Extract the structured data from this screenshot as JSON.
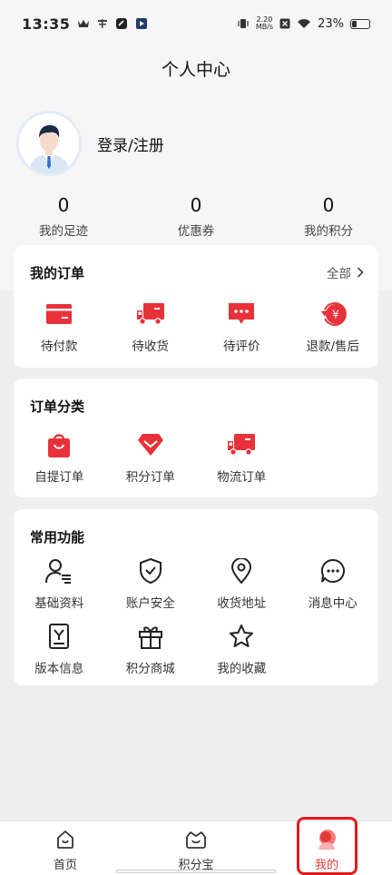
{
  "status_bar": {
    "time": "13:35",
    "speed_top": "2.20",
    "speed_bottom": "MB/s",
    "battery": "23%",
    "left_icons": [
      "crown-icon",
      "qin-app-icon",
      "link-app-icon",
      "play-app-icon"
    ],
    "right_icons": [
      "vibrate-icon",
      "x-app-icon",
      "wifi-icon",
      "battery-icon"
    ]
  },
  "header": {
    "title": "个人中心"
  },
  "profile": {
    "login_label": "登录/注册",
    "avatar_icon": "default-avatar"
  },
  "stats": [
    {
      "value": "0",
      "label": "我的足迹"
    },
    {
      "value": "0",
      "label": "优惠券"
    },
    {
      "value": "0",
      "label": "我的积分"
    }
  ],
  "orders": {
    "title": "我的订单",
    "more_label": "全部",
    "items": [
      {
        "label": "待付款",
        "icon": "wallet-card-icon"
      },
      {
        "label": "待收货",
        "icon": "truck-icon"
      },
      {
        "label": "待评价",
        "icon": "comment-icon"
      },
      {
        "label": "退款/售后",
        "icon": "refund-yen-icon"
      }
    ]
  },
  "categories": {
    "title": "订单分类",
    "items": [
      {
        "label": "自提订单",
        "icon": "shopping-bag-icon"
      },
      {
        "label": "积分订单",
        "icon": "diamond-icon"
      },
      {
        "label": "物流订单",
        "icon": "truck-icon"
      }
    ]
  },
  "functions": {
    "title": "常用功能",
    "row1": [
      {
        "label": "基础资料",
        "icon": "user-profile-icon"
      },
      {
        "label": "账户安全",
        "icon": "shield-check-icon"
      },
      {
        "label": "收货地址",
        "icon": "location-pin-icon"
      },
      {
        "label": "消息中心",
        "icon": "chat-bubble-icon"
      }
    ],
    "row2": [
      {
        "label": "版本信息",
        "icon": "version-doc-icon"
      },
      {
        "label": "积分商城",
        "icon": "gift-icon"
      },
      {
        "label": "我的收藏",
        "icon": "star-icon"
      }
    ]
  },
  "tab_bar": {
    "tabs": [
      {
        "label": "首页",
        "icon": "home-icon"
      },
      {
        "label": "积分宝",
        "icon": "points-basket-icon"
      },
      {
        "label": "我的",
        "icon": "mine-icon",
        "active": true
      }
    ]
  },
  "colors": {
    "accent": "#e23a3a",
    "highlight": "#e31a1a",
    "page_bg": "#efefef"
  }
}
